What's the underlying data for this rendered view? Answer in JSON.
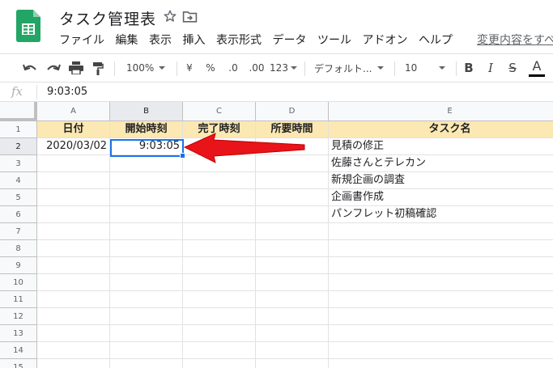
{
  "app": {
    "doc_title": "タスク管理表",
    "menu": [
      "ファイル",
      "編集",
      "表示",
      "挿入",
      "表示形式",
      "データ",
      "ツール",
      "アドオン",
      "ヘルプ"
    ],
    "changes_link": "変更内容をすべ",
    "logo_icon": "sheets-logo-icon",
    "brand_color": "#23a566"
  },
  "toolbar": {
    "zoom": "100%",
    "currency": "¥",
    "percent": "%",
    "dec_decrease": ".0",
    "dec_increase": ".00",
    "more_formats": "123",
    "font": "デフォルト...",
    "font_size": "10",
    "bold": "B",
    "italic": "I",
    "strike": "S",
    "text_color": "A"
  },
  "formula_bar": {
    "fx": "fx",
    "value": "9:03:05"
  },
  "sheet": {
    "columns": [
      "A",
      "B",
      "C",
      "D",
      "E"
    ],
    "rows": [
      "1",
      "2",
      "3",
      "4",
      "5",
      "6",
      "7",
      "8",
      "9",
      "10",
      "11",
      "12",
      "13",
      "14",
      "15"
    ],
    "header": [
      "日付",
      "開始時刻",
      "完了時刻",
      "所要時間",
      "タスク名"
    ],
    "data": [
      [
        "2020/03/02",
        "9:03:05",
        "",
        "",
        "見積の修正"
      ],
      [
        "",
        "",
        "",
        "",
        "佐藤さんとテレカン"
      ],
      [
        "",
        "",
        "",
        "",
        "新規企画の調査"
      ],
      [
        "",
        "",
        "",
        "",
        "企画書作成"
      ],
      [
        "",
        "",
        "",
        "",
        "パンフレット初稿確認"
      ]
    ],
    "selected_cell": "B2",
    "header_fill": "#fce8b2",
    "selection_color": "#1a73e8",
    "annotation_arrow_color": "#e8141a"
  }
}
